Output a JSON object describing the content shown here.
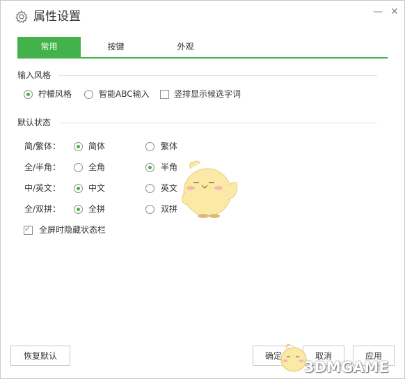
{
  "window": {
    "title": "属性设置",
    "minimize_label": "—",
    "close_label": "✕"
  },
  "tabs": [
    {
      "label": "常用",
      "active": true
    },
    {
      "label": "按键",
      "active": false
    },
    {
      "label": "外观",
      "active": false
    }
  ],
  "input_style": {
    "title": "输入风格",
    "options": [
      {
        "label": "柠檬风格",
        "checked": true
      },
      {
        "label": "智能ABC输入",
        "checked": false
      }
    ],
    "vertical_checkbox": {
      "label": "竖排显示候选字词",
      "checked": false
    }
  },
  "default_state": {
    "title": "默认状态",
    "rows": [
      {
        "label": "简/繁体：",
        "options": [
          {
            "label": "简体",
            "checked": true
          },
          {
            "label": "繁体",
            "checked": false
          }
        ]
      },
      {
        "label": "全/半角：",
        "options": [
          {
            "label": "全角",
            "checked": false
          },
          {
            "label": "半角",
            "checked": true
          }
        ]
      },
      {
        "label": "中/英文：",
        "options": [
          {
            "label": "中文",
            "checked": true
          },
          {
            "label": "英文",
            "checked": false
          }
        ]
      },
      {
        "label": "全/双拼：",
        "options": [
          {
            "label": "全拼",
            "checked": true
          },
          {
            "label": "双拼",
            "checked": false
          }
        ]
      }
    ],
    "fullscreen_checkbox": {
      "label": "全屏时隐藏状态栏",
      "checked": true
    }
  },
  "buttons": {
    "restore_default": "恢复默认",
    "ok": "确定",
    "cancel": "取消",
    "apply": "应用"
  },
  "watermark": {
    "text": "3DMGAME"
  },
  "colors": {
    "accent": "#43b24a",
    "mascot_body": "#fbe9a6",
    "mascot_cheek": "#f8b6b0"
  },
  "icons": {
    "title": "gear-icon",
    "check": "check-icon"
  }
}
